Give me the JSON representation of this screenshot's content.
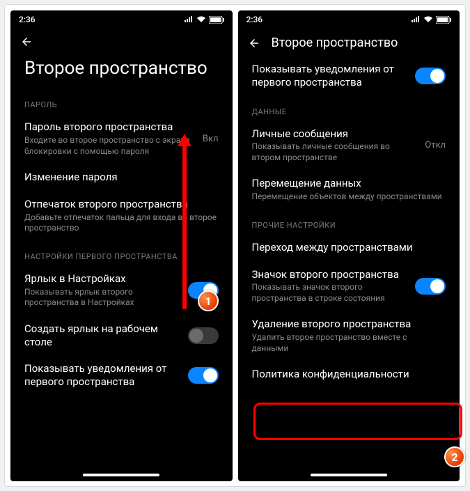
{
  "status": {
    "time": "2:36"
  },
  "left": {
    "title": "Второе пространство",
    "sections": {
      "password": {
        "head": "ПАРОЛЬ",
        "pwd": {
          "title": "Пароль второго пространства",
          "sub": "Входите во второе пространство с экрана блокировки с помощью пароля",
          "value": "Вкл"
        },
        "change": {
          "title": "Изменение пароля"
        },
        "finger": {
          "title": "Отпечаток второго пространства",
          "sub": "Добавьте отпечаток пальца для входа во второе пространство"
        }
      },
      "first_space": {
        "head": "НАСТРОЙКИ ПЕРВОГО ПРОСТРАНСТВА",
        "shortcut": {
          "title": "Ярлык в Настройках",
          "sub": "Показывать ярлык второго пространства в Настройках"
        },
        "desktop": {
          "title": "Создать ярлык на рабочем столе"
        },
        "notify": {
          "title": "Показывать уведомления от первого пространства"
        }
      }
    }
  },
  "right": {
    "topbar_title": "Второе пространство",
    "notify": {
      "title": "Показывать уведомления от первого пространства"
    },
    "data": {
      "head": "ДАННЫЕ",
      "msgs": {
        "title": "Личные сообщения",
        "sub": "Показывать личные сообщения во втором пространстве",
        "value": "Откл"
      },
      "move": {
        "title": "Перемещение данных",
        "sub": "Перемещение объектов между пространствами"
      }
    },
    "other": {
      "head": "ПРОЧИЕ НАСТРОЙКИ",
      "switch": {
        "title": "Переход между пространствами"
      },
      "icon": {
        "title": "Значок второго пространства",
        "sub": "Показывать значок второго пространства в строке состояния"
      },
      "delete": {
        "title": "Удаление второго пространства",
        "sub": "Удалить второе пространство вместе с данными"
      },
      "privacy": {
        "title": "Политика конфиденциальности"
      }
    }
  },
  "annotations": {
    "badge1": "1",
    "badge2": "2"
  }
}
